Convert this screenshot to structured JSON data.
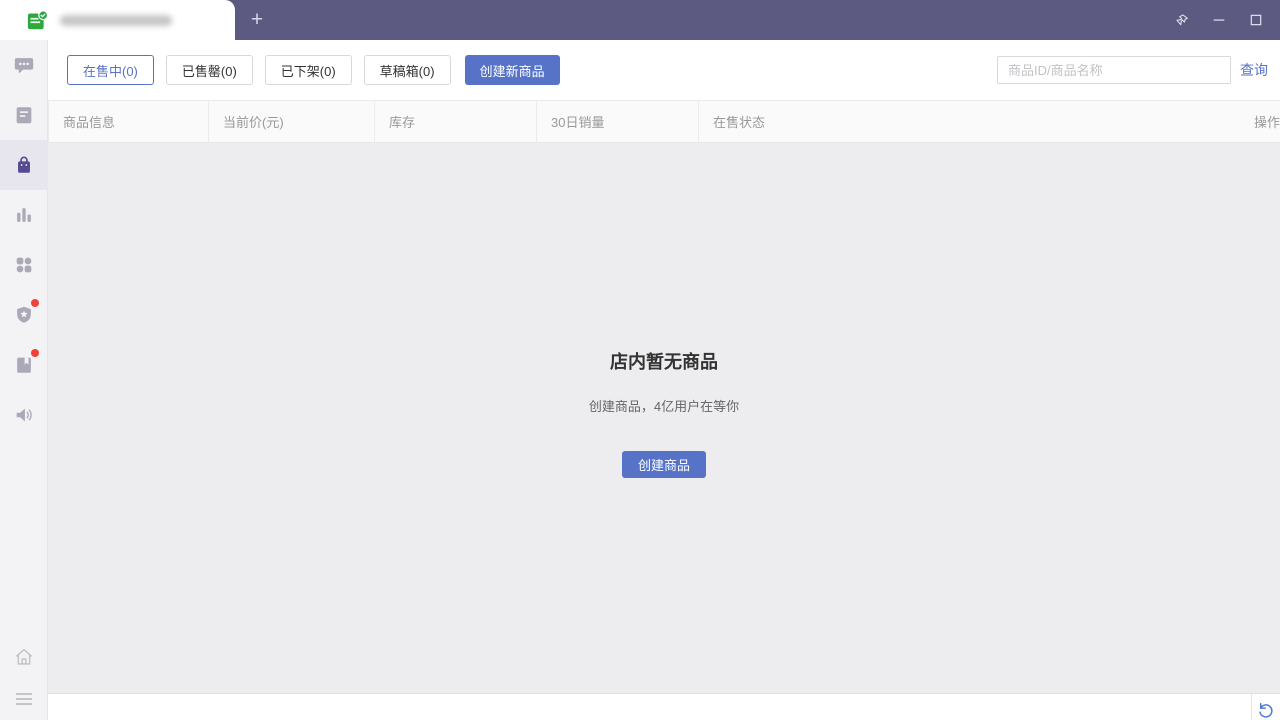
{
  "titlebar": {
    "tab": {
      "favicon": "green-check-app-icon",
      "title": "",
      "title_blurred": true
    },
    "new_tab_label": "+",
    "window_controls": [
      "pin",
      "minimize",
      "maximize"
    ]
  },
  "sidebar": {
    "items": [
      {
        "icon": "chat-bubble-icon",
        "active": false,
        "badge": false
      },
      {
        "icon": "order-list-icon",
        "active": false,
        "badge": false
      },
      {
        "icon": "shopping-bag-icon",
        "active": true,
        "badge": false
      },
      {
        "icon": "bar-chart-icon",
        "active": false,
        "badge": false
      },
      {
        "icon": "apps-grid-icon",
        "active": false,
        "badge": false
      },
      {
        "icon": "shield-star-icon",
        "active": false,
        "badge": true
      },
      {
        "icon": "book-bookmark-icon",
        "active": false,
        "badge": true
      },
      {
        "icon": "speaker-icon",
        "active": false,
        "badge": false
      }
    ],
    "bottom_items": [
      {
        "icon": "home-icon"
      },
      {
        "icon": "hamburger-menu-icon"
      }
    ]
  },
  "toolbar": {
    "filters": [
      {
        "label": "在售中(0)",
        "active": true
      },
      {
        "label": "已售罄(0)",
        "active": false
      },
      {
        "label": "已下架(0)",
        "active": false
      },
      {
        "label": "草稿箱(0)",
        "active": false
      }
    ],
    "create_button_label": "创建新商品",
    "search": {
      "placeholder": "商品ID/商品名称",
      "value": "",
      "submit_label": "查询"
    }
  },
  "table": {
    "columns": [
      "商品信息",
      "当前价(元)",
      "库存",
      "30日销量",
      "在售状态",
      "操作"
    ],
    "rows": []
  },
  "empty_state": {
    "title": "店内暂无商品",
    "subtitle": "创建商品，4亿用户在等你",
    "button_label": "创建商品"
  },
  "colors": {
    "titlebar": "#5D5A82",
    "accent": "#5673C8",
    "sidebar_icon": "#ABA9B8",
    "sidebar_active_icon": "#564A92",
    "badge_red": "#EF4238",
    "content_bg": "#EDEDEF"
  }
}
